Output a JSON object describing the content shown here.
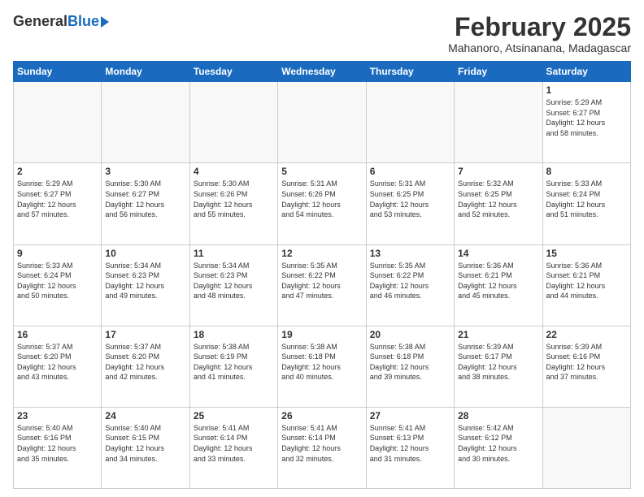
{
  "logo": {
    "general": "General",
    "blue": "Blue"
  },
  "title": {
    "month_year": "February 2025",
    "location": "Mahanoro, Atsinanana, Madagascar"
  },
  "days_of_week": [
    "Sunday",
    "Monday",
    "Tuesday",
    "Wednesday",
    "Thursday",
    "Friday",
    "Saturday"
  ],
  "weeks": [
    [
      {
        "num": "",
        "info": ""
      },
      {
        "num": "",
        "info": ""
      },
      {
        "num": "",
        "info": ""
      },
      {
        "num": "",
        "info": ""
      },
      {
        "num": "",
        "info": ""
      },
      {
        "num": "",
        "info": ""
      },
      {
        "num": "1",
        "info": "Sunrise: 5:29 AM\nSunset: 6:27 PM\nDaylight: 12 hours\nand 58 minutes."
      }
    ],
    [
      {
        "num": "2",
        "info": "Sunrise: 5:29 AM\nSunset: 6:27 PM\nDaylight: 12 hours\nand 57 minutes."
      },
      {
        "num": "3",
        "info": "Sunrise: 5:30 AM\nSunset: 6:27 PM\nDaylight: 12 hours\nand 56 minutes."
      },
      {
        "num": "4",
        "info": "Sunrise: 5:30 AM\nSunset: 6:26 PM\nDaylight: 12 hours\nand 55 minutes."
      },
      {
        "num": "5",
        "info": "Sunrise: 5:31 AM\nSunset: 6:26 PM\nDaylight: 12 hours\nand 54 minutes."
      },
      {
        "num": "6",
        "info": "Sunrise: 5:31 AM\nSunset: 6:25 PM\nDaylight: 12 hours\nand 53 minutes."
      },
      {
        "num": "7",
        "info": "Sunrise: 5:32 AM\nSunset: 6:25 PM\nDaylight: 12 hours\nand 52 minutes."
      },
      {
        "num": "8",
        "info": "Sunrise: 5:33 AM\nSunset: 6:24 PM\nDaylight: 12 hours\nand 51 minutes."
      }
    ],
    [
      {
        "num": "9",
        "info": "Sunrise: 5:33 AM\nSunset: 6:24 PM\nDaylight: 12 hours\nand 50 minutes."
      },
      {
        "num": "10",
        "info": "Sunrise: 5:34 AM\nSunset: 6:23 PM\nDaylight: 12 hours\nand 49 minutes."
      },
      {
        "num": "11",
        "info": "Sunrise: 5:34 AM\nSunset: 6:23 PM\nDaylight: 12 hours\nand 48 minutes."
      },
      {
        "num": "12",
        "info": "Sunrise: 5:35 AM\nSunset: 6:22 PM\nDaylight: 12 hours\nand 47 minutes."
      },
      {
        "num": "13",
        "info": "Sunrise: 5:35 AM\nSunset: 6:22 PM\nDaylight: 12 hours\nand 46 minutes."
      },
      {
        "num": "14",
        "info": "Sunrise: 5:36 AM\nSunset: 6:21 PM\nDaylight: 12 hours\nand 45 minutes."
      },
      {
        "num": "15",
        "info": "Sunrise: 5:36 AM\nSunset: 6:21 PM\nDaylight: 12 hours\nand 44 minutes."
      }
    ],
    [
      {
        "num": "16",
        "info": "Sunrise: 5:37 AM\nSunset: 6:20 PM\nDaylight: 12 hours\nand 43 minutes."
      },
      {
        "num": "17",
        "info": "Sunrise: 5:37 AM\nSunset: 6:20 PM\nDaylight: 12 hours\nand 42 minutes."
      },
      {
        "num": "18",
        "info": "Sunrise: 5:38 AM\nSunset: 6:19 PM\nDaylight: 12 hours\nand 41 minutes."
      },
      {
        "num": "19",
        "info": "Sunrise: 5:38 AM\nSunset: 6:18 PM\nDaylight: 12 hours\nand 40 minutes."
      },
      {
        "num": "20",
        "info": "Sunrise: 5:38 AM\nSunset: 6:18 PM\nDaylight: 12 hours\nand 39 minutes."
      },
      {
        "num": "21",
        "info": "Sunrise: 5:39 AM\nSunset: 6:17 PM\nDaylight: 12 hours\nand 38 minutes."
      },
      {
        "num": "22",
        "info": "Sunrise: 5:39 AM\nSunset: 6:16 PM\nDaylight: 12 hours\nand 37 minutes."
      }
    ],
    [
      {
        "num": "23",
        "info": "Sunrise: 5:40 AM\nSunset: 6:16 PM\nDaylight: 12 hours\nand 35 minutes."
      },
      {
        "num": "24",
        "info": "Sunrise: 5:40 AM\nSunset: 6:15 PM\nDaylight: 12 hours\nand 34 minutes."
      },
      {
        "num": "25",
        "info": "Sunrise: 5:41 AM\nSunset: 6:14 PM\nDaylight: 12 hours\nand 33 minutes."
      },
      {
        "num": "26",
        "info": "Sunrise: 5:41 AM\nSunset: 6:14 PM\nDaylight: 12 hours\nand 32 minutes."
      },
      {
        "num": "27",
        "info": "Sunrise: 5:41 AM\nSunset: 6:13 PM\nDaylight: 12 hours\nand 31 minutes."
      },
      {
        "num": "28",
        "info": "Sunrise: 5:42 AM\nSunset: 6:12 PM\nDaylight: 12 hours\nand 30 minutes."
      },
      {
        "num": "",
        "info": ""
      }
    ]
  ]
}
